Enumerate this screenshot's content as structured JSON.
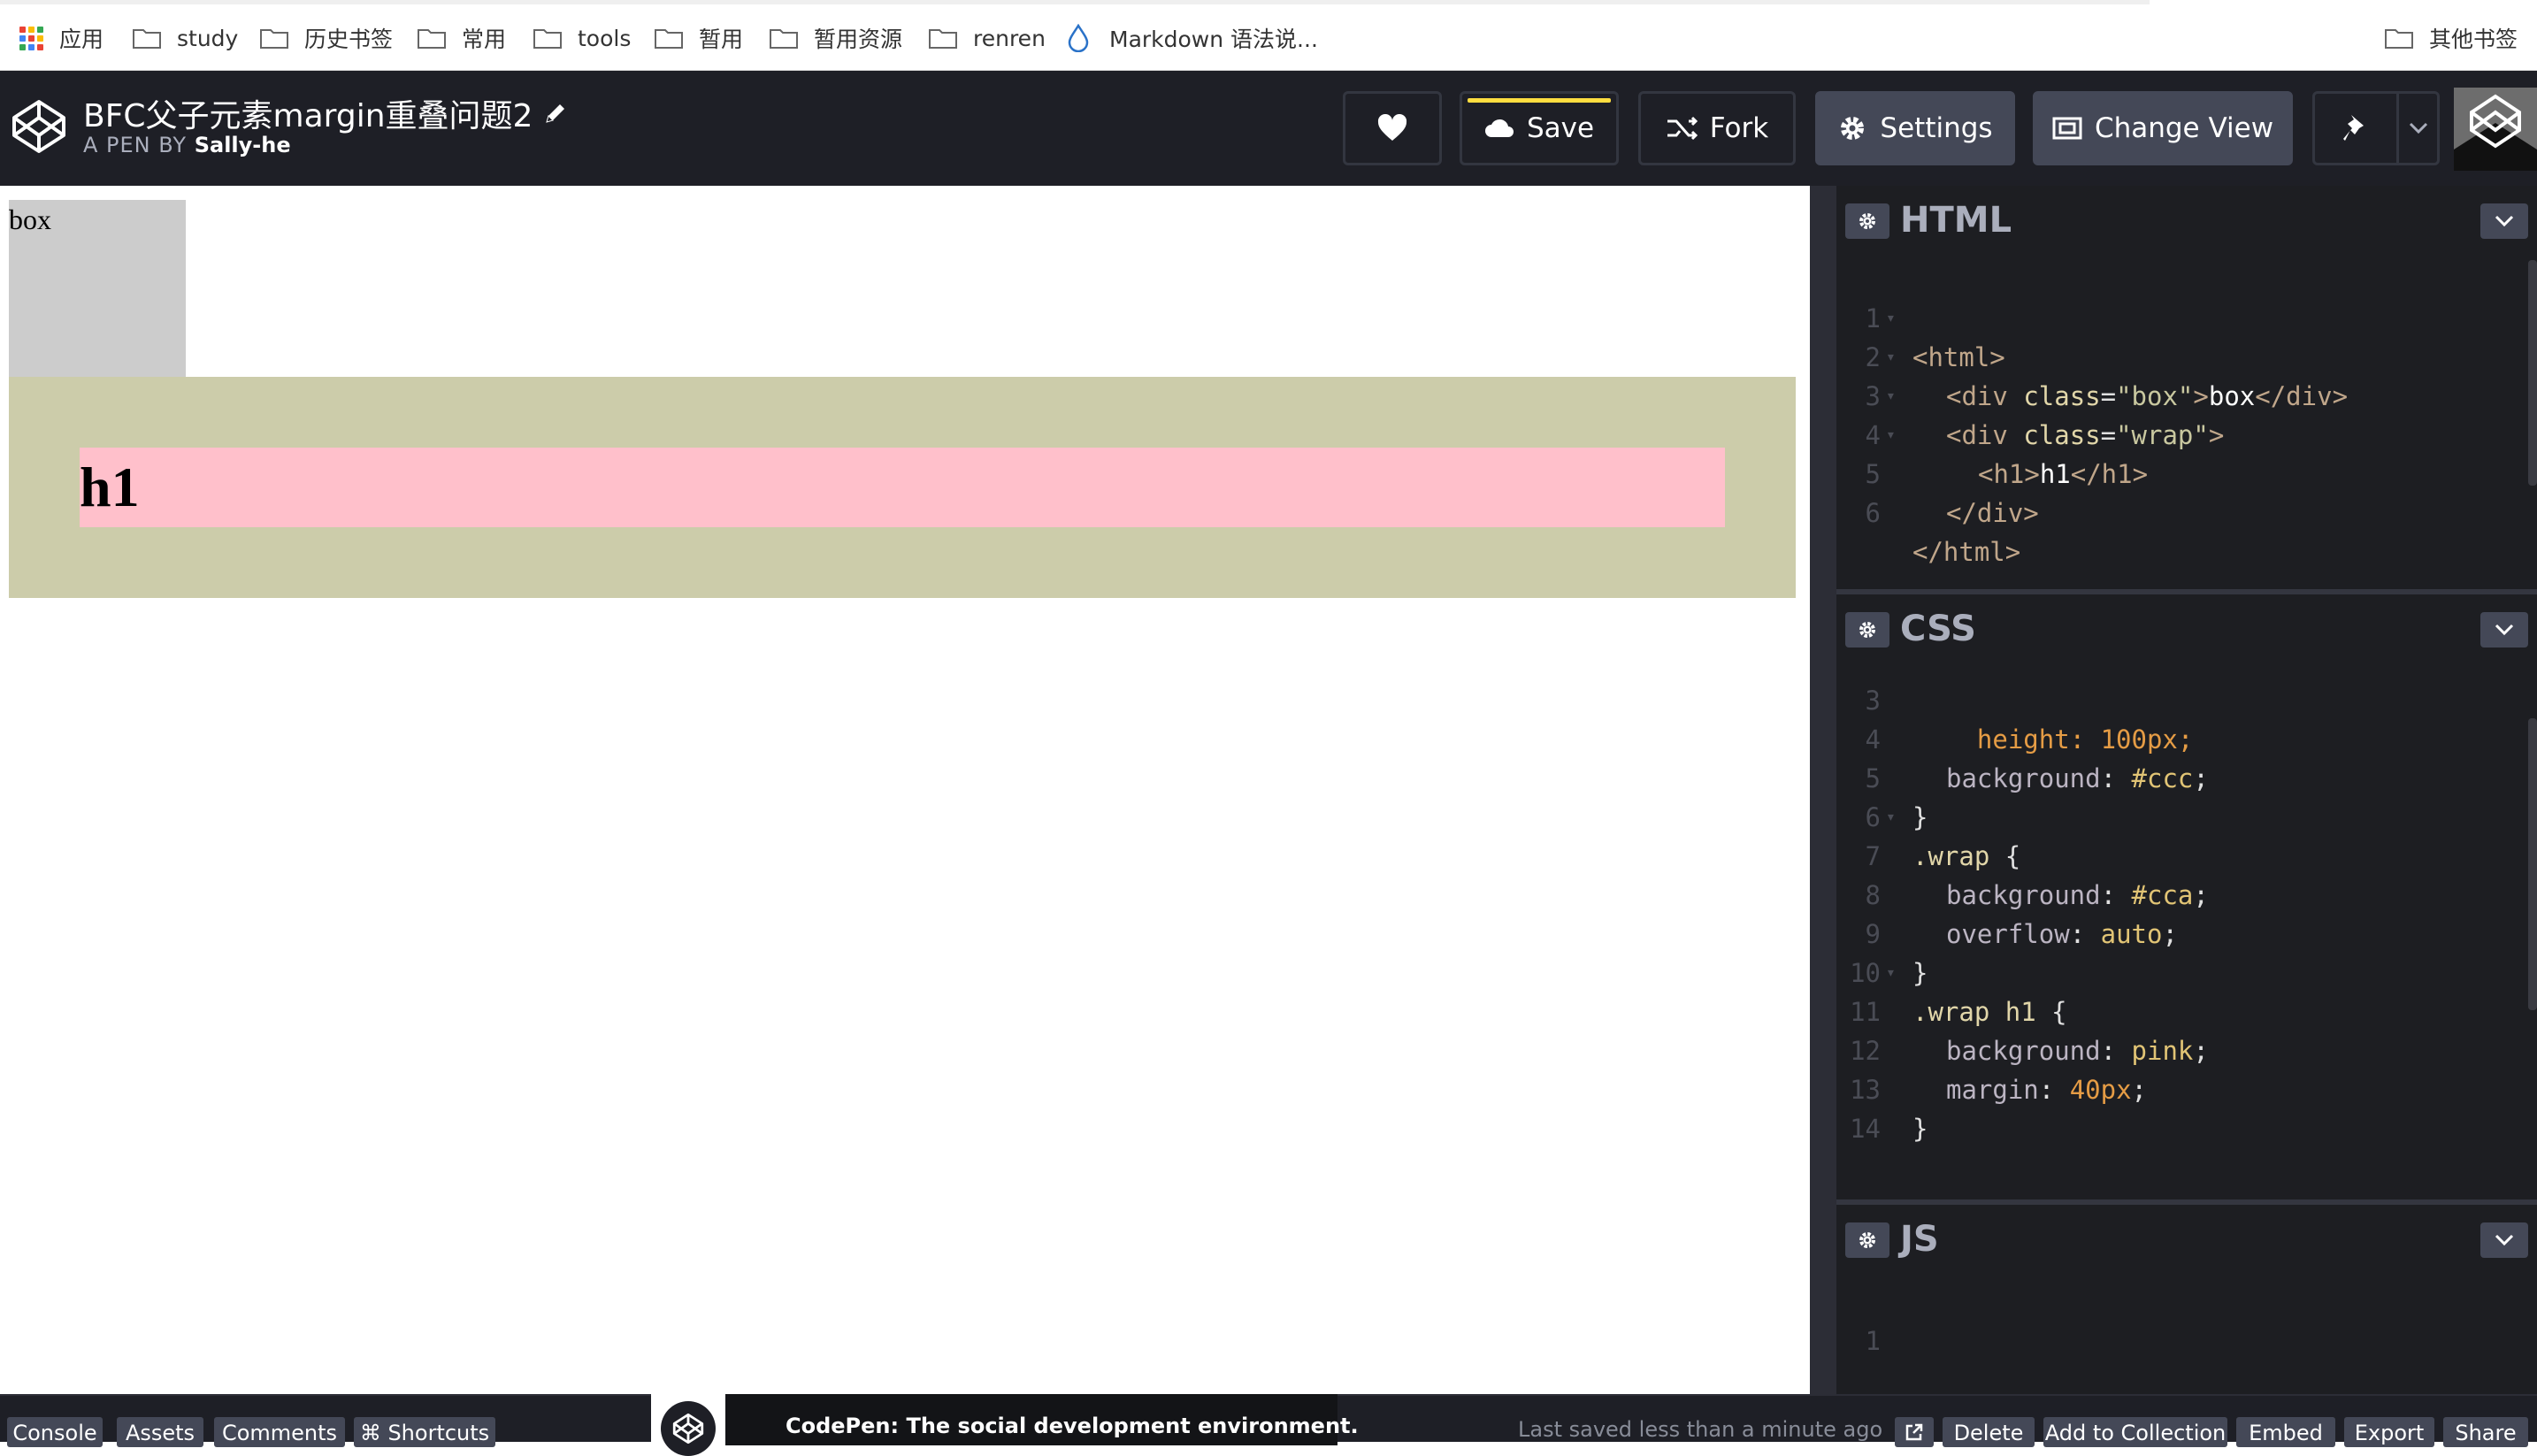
{
  "bookmarks": {
    "apps_label": "应用",
    "items": [
      "study",
      "历史书签",
      "常用",
      "tools",
      "暂用",
      "暂用资源",
      "renren",
      "Markdown 语法说..."
    ],
    "other_label": "其他书签"
  },
  "header": {
    "title": "BFC父子元素margin重叠问题2",
    "by_prefix": "A PEN BY",
    "author": "Sally-he",
    "save_label": "Save",
    "fork_label": "Fork",
    "settings_label": "Settings",
    "change_view_label": "Change View"
  },
  "preview": {
    "box_text": "box",
    "h1_text": "h1"
  },
  "editors": {
    "html": {
      "title": "HTML",
      "lines": [
        {
          "n": "1",
          "fold": true
        },
        {
          "n": "2",
          "fold": true
        },
        {
          "n": "3",
          "fold": true
        },
        {
          "n": "4",
          "fold": true
        },
        {
          "n": "5",
          "fold": false
        },
        {
          "n": "6",
          "fold": false
        }
      ]
    },
    "css": {
      "title": "CSS",
      "partial_line": "  height: 100px;",
      "lines": [
        {
          "n": "3"
        },
        {
          "n": "4"
        },
        {
          "n": "5"
        },
        {
          "n": "6"
        },
        {
          "n": "7"
        },
        {
          "n": "8"
        },
        {
          "n": "9"
        },
        {
          "n": "10"
        },
        {
          "n": "11"
        },
        {
          "n": "12"
        },
        {
          "n": "13"
        },
        {
          "n": "14"
        }
      ]
    },
    "js": {
      "title": "JS",
      "lines": [
        {
          "n": "1"
        }
      ]
    }
  },
  "code_tokens": {
    "html": {
      "l1": "<html>",
      "l2_open": "<div ",
      "l2_attr": "class",
      "l2_eq": "=",
      "l2_str": "\"box\"",
      "l2_gt": ">",
      "l2_txt": "box",
      "l2_close": "</div>",
      "l3_open": "<div ",
      "l3_attr": "class",
      "l3_eq": "=",
      "l3_str": "\"wrap\"",
      "l3_gt": ">",
      "l4_open": "<h1>",
      "l4_txt": "h1",
      "l4_close": "</h1>",
      "l5": "</div>",
      "l6": "</html>"
    },
    "css": {
      "l4_prop": "background",
      "l4_colon": ": ",
      "l4_val": "#ccc",
      "l4_semi": ";",
      "l5": "}",
      "l6_sel": ".wrap",
      "l6_brace": " {",
      "l7_prop": "background",
      "l7_colon": ": ",
      "l7_val": "#cca",
      "l7_semi": ";",
      "l8_prop": "overflow",
      "l8_colon": ": ",
      "l8_val": "auto",
      "l8_semi": ";",
      "l9": "}",
      "l10_sel": ".wrap h1",
      "l10_brace": " {",
      "l11_prop": "background",
      "l11_colon": ": ",
      "l11_val": "pink",
      "l11_semi": ";",
      "l12_prop": "margin",
      "l12_colon": ": ",
      "l12_val": "40px",
      "l12_semi": ";",
      "l13": "}"
    }
  },
  "footer": {
    "console_label": "Console",
    "assets_label": "Assets",
    "comments_label": "Comments",
    "shortcuts_label": "⌘ Shortcuts",
    "promo_text": "CodePen: The social development environment.",
    "last_saved": "Last saved less than a minute ago",
    "delete_label": "Delete",
    "add_to_collection_label": "Add to Collection",
    "embed_label": "Embed",
    "export_label": "Export",
    "share_label": "Share"
  },
  "colors": {
    "header_bg": "#1e1f26",
    "editor_bg": "#1d1e22",
    "save_accent": "#ffdd40",
    "box_bg": "#cccccc",
    "wrap_bg": "#ccccaa",
    "h1_bg": "pink"
  },
  "icons": [
    "apps-grid-icon",
    "folder-icon",
    "drop-icon",
    "codepen-logo-icon",
    "pencil-icon",
    "heart-icon",
    "cloud-icon",
    "fork-icon",
    "gear-icon",
    "change-view-icon",
    "pin-icon",
    "chevron-down-icon",
    "external-link-icon"
  ]
}
